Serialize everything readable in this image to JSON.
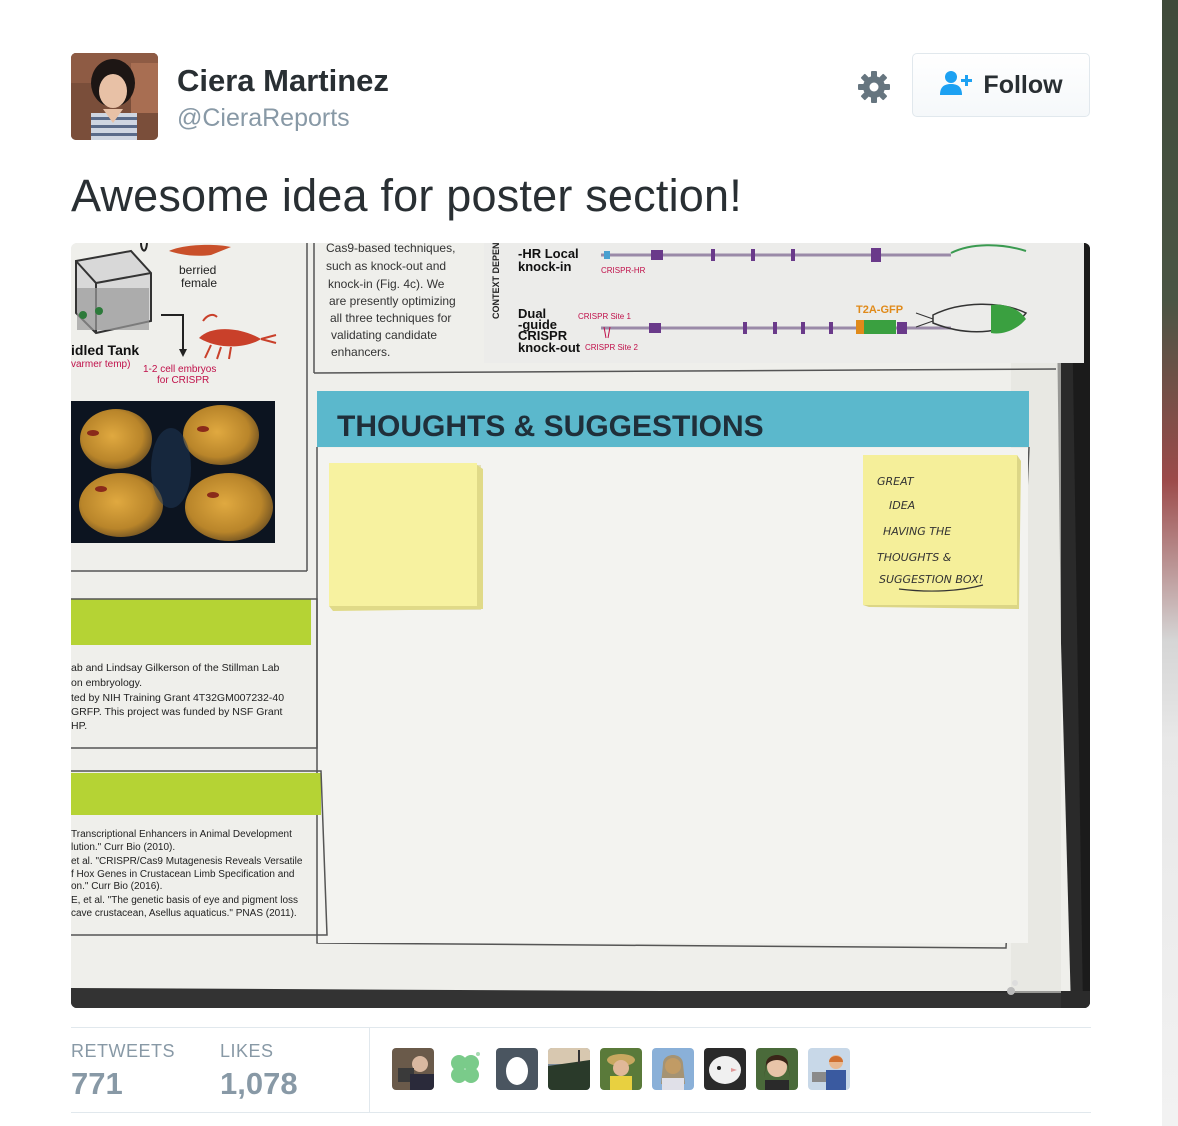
{
  "user": {
    "name": "Ciera Martinez",
    "handle": "@CieraReports"
  },
  "actions": {
    "follow_label": "Follow"
  },
  "icons": {
    "gear": "gear-icon",
    "follow": "add-user-icon"
  },
  "tweet": {
    "text": "Awesome idea for poster section!"
  },
  "poster": {
    "section_title": "THOUGHTS & SUGGESTIONS",
    "sticky_note_text": [
      "GREAT",
      "IDEA",
      "HAVING THE",
      "THOUGHTS &",
      "SUGGESTION BOX!"
    ],
    "method_text": [
      "Cas9-based techniques,",
      "such as knock-out and",
      "knock-in (Fig. 4c). We",
      "are presently optimizing",
      "all three techniques for",
      "validating candidate",
      "enhancers."
    ],
    "context_label": "CONTEXT DEPENDENT",
    "hr_label": [
      "-HR Local",
      "knock-in"
    ],
    "crispr_hr": "CRISPR-HR",
    "dual_label": [
      "Dual",
      "-guide",
      "CRISPR",
      "knock-out"
    ],
    "site1": "CRISPR Site 1",
    "site2": "CRISPR Site 2",
    "t2a": "T2A-GFP",
    "berried": [
      "berried",
      "female"
    ],
    "tank_label": "idled Tank",
    "tank_sub": "varmer temp)",
    "embryos": [
      "1-2 cell embryos",
      "for CRISPR"
    ],
    "ack_text": [
      "ab and Lindsay Gilkerson of the Stillman Lab",
      "on embryology.",
      "ted by NIH Training Grant 4T32GM007232-40",
      "GRFP. This project was funded by NSF Grant",
      "HP."
    ],
    "ref_text": [
      "Transcriptional Enhancers in Animal Development",
      "lution.\" Curr Bio (2010).",
      "et al. \"CRISPR/Cas9 Mutagenesis Reveals Versatile",
      "f Hox Genes in Crustacean Limb Specification and",
      "on.\" Curr Bio (2016).",
      "E, et al. \"The genetic basis of eye and pigment loss",
      " cave crustacean, Asellus aquaticus.\" PNAS (2011)."
    ]
  },
  "stats": {
    "retweets_label": "RETWEETS",
    "retweets_value": "771",
    "likes_label": "LIKES",
    "likes_value": "1,078"
  },
  "colors": {
    "banner": "#5bb8cc",
    "sticky": "#f7f2a0",
    "green_bar": "#b5d334",
    "accent_blue": "#1da1f2"
  }
}
